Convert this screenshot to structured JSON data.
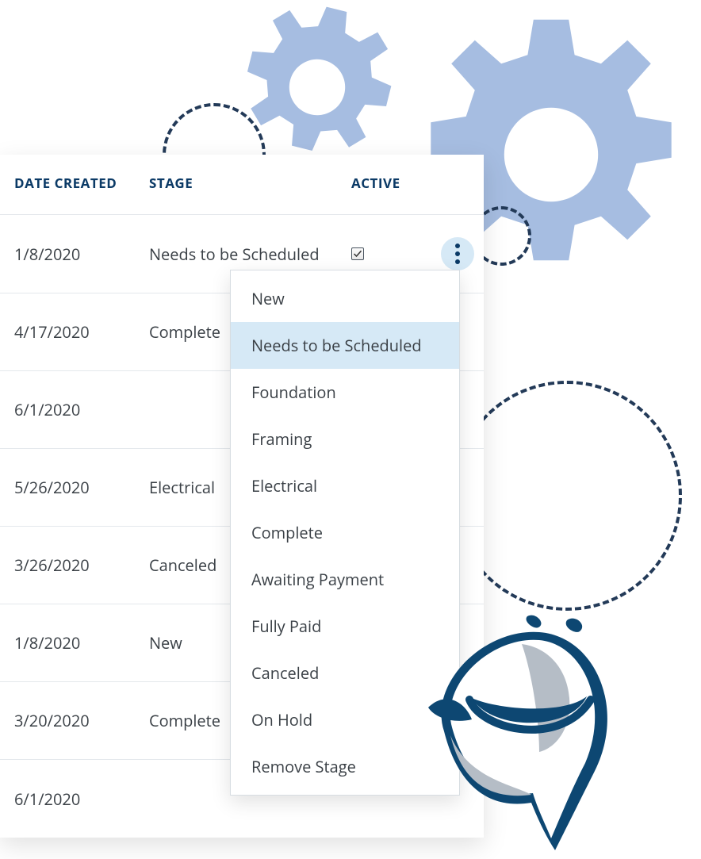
{
  "table": {
    "headers": {
      "date": "DATE CREATED",
      "stage": "STAGE",
      "active": "ACTIVE"
    },
    "rows": [
      {
        "date": "1/8/2020",
        "stage": "Needs to be Scheduled",
        "active": true
      },
      {
        "date": "4/17/2020",
        "stage": "Complete",
        "active": false
      },
      {
        "date": "6/1/2020",
        "stage": "",
        "active": false
      },
      {
        "date": "5/26/2020",
        "stage": "Electrical",
        "active": false
      },
      {
        "date": "3/26/2020",
        "stage": "Canceled",
        "active": false
      },
      {
        "date": "1/8/2020",
        "stage": "New",
        "active": false
      },
      {
        "date": "3/20/2020",
        "stage": "Complete",
        "active": false
      },
      {
        "date": "6/1/2020",
        "stage": "",
        "active": false
      }
    ]
  },
  "dropdown": {
    "selected_index": 1,
    "items": [
      "New",
      "Needs to be Scheduled",
      "Foundation",
      "Framing",
      "Electrical",
      "Complete",
      "Awaiting Payment",
      "Fully Paid",
      "Canceled",
      "On Hold",
      "Remove Stage"
    ]
  }
}
